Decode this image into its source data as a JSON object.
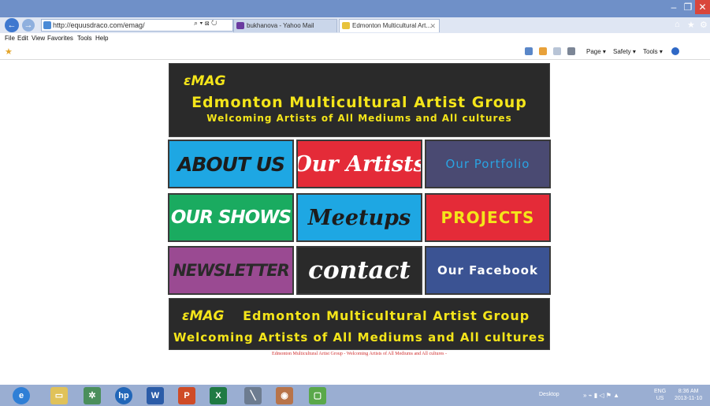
{
  "browser": {
    "url": "http://equusdraco.com/emag/",
    "url_host": "equusdraco.com",
    "tabs": [
      {
        "label": "bukhanova - Yahoo Mail"
      },
      {
        "label": "Edmonton Multicultural Art..."
      }
    ],
    "menu": [
      "File",
      "Edit",
      "View",
      "Favorites",
      "Tools",
      "Help"
    ],
    "commands": [
      "Page ▾",
      "Safety ▾",
      "Tools ▾"
    ]
  },
  "page": {
    "header": {
      "logo": "εMAG",
      "title": "Edmonton Multicultural Artist Group",
      "subtitle": "Welcoming Artists of All Mediums and All cultures"
    },
    "tiles": [
      {
        "label": "ABOUT US",
        "color": "#1ea7e3"
      },
      {
        "label": "Our Artists",
        "color": "#e42b38"
      },
      {
        "label": "Our Portfolio",
        "color": "#4a4a72"
      },
      {
        "label": "OUR SHOWS",
        "color": "#1aab60"
      },
      {
        "label": "Meetups",
        "color": "#1ea7e3"
      },
      {
        "label": "PROJECTS",
        "color": "#e42b38"
      },
      {
        "label": "NEWSLETTER",
        "color": "#9a4a92"
      },
      {
        "label": "contact",
        "color": "#2a2a2a"
      },
      {
        "label": "Our Facebook",
        "color": "#3b5393"
      }
    ],
    "footer": {
      "logo": "εMAG",
      "title": "Edmonton Multicultural Artist Group",
      "subtitle": "Welcoming Artists of All Mediums and All cultures",
      "note": "Edmonton Multicultural Artist Group - Welcoming Artists of All Mediums and All cultures -"
    },
    "accent_color": "#f4e51a"
  },
  "taskbar": {
    "desktop_label": "Desktop",
    "lang": "ENG",
    "region": "US",
    "time": "8:36 AM",
    "date": "2013-11-10"
  }
}
